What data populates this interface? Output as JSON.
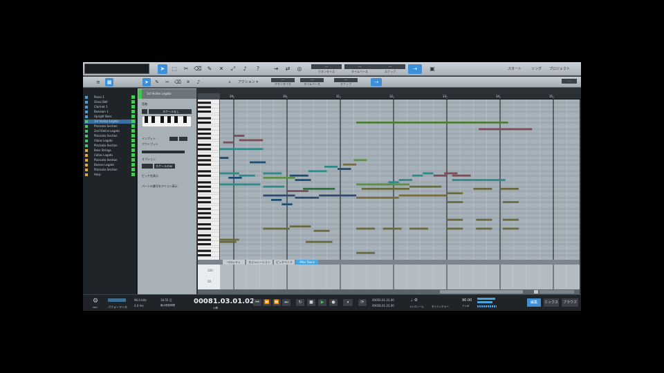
{
  "toolbar": {
    "tools": [
      "arrow",
      "range",
      "split",
      "eraser",
      "paint",
      "mute",
      "bend",
      "listen",
      "help"
    ],
    "groups": [
      {
        "value": "---",
        "caption": "クオンタイズ"
      },
      {
        "value": "---",
        "caption": "タイムベース"
      },
      {
        "value": "---",
        "caption": "スナップ"
      }
    ],
    "nav": {
      "start": "スタート",
      "song": "ソング",
      "project": "プロジェクト"
    }
  },
  "editor_toolbar": {
    "action_label": "アクション ▾",
    "groups": [
      {
        "value": "---",
        "caption": "クオンタイズ"
      },
      {
        "value": "---",
        "caption": "タイムベース"
      },
      {
        "value": "---",
        "caption": "スナップ"
      }
    ]
  },
  "tracks": [
    {
      "name": "Piano 1",
      "color": "#4f9bd6"
    },
    {
      "name": "Glass Bell",
      "color": "#4f9bd6"
    },
    {
      "name": "Clarinet 1",
      "color": "#4f9bd6"
    },
    {
      "name": "Bassoon 1",
      "color": "#4f9bd6"
    },
    {
      "name": "Upright Bass",
      "color": "#4f9bd6"
    },
    {
      "name": "1st Violins Legato",
      "color": "#4fbf6c"
    },
    {
      "name": "Pizzicato Section",
      "color": "#4fbf6c"
    },
    {
      "name": "2nd Violins Legato",
      "color": "#4fbf6c"
    },
    {
      "name": "Pizzicato Section",
      "color": "#4fbf6c"
    },
    {
      "name": "Violas Legato",
      "color": "#4fbf6c"
    },
    {
      "name": "Pizzicato Section",
      "color": "#4fbf6c"
    },
    {
      "name": "Bass Strings",
      "color": "#e0a53c"
    },
    {
      "name": "Cellos Legato",
      "color": "#e0a53c"
    },
    {
      "name": "Pizzicato Section",
      "color": "#e0a53c"
    },
    {
      "name": "Basses Legato",
      "color": "#e0a53c"
    },
    {
      "name": "Pizzicato Section",
      "color": "#e0a53c"
    },
    {
      "name": "Harp",
      "color": "#e0a53c"
    }
  ],
  "inspector": {
    "instrument": "1st Violins Legato",
    "scale_label": "音階",
    "scale_value": "スケールなし",
    "input_label": "インプット",
    "output_label": "アウトプット",
    "option_label": "オプション",
    "option_value": "スケールのみ",
    "pitch_label": "ピッチ名表示",
    "hint_label": "パートの番号をアイコン表示"
  },
  "ruler": {
    "bars": [
      "29",
      "30",
      "31",
      "32",
      "33",
      "34",
      "35"
    ]
  },
  "editor_tabs": [
    "ベロシティ",
    "モジュレーション",
    "ピッチベンド",
    "After Touch"
  ],
  "vel_lane_labels": [
    "100",
    "50"
  ],
  "transport": {
    "midi_perf_label": "MIDI",
    "perf_label": "パフォーマンス",
    "sample_rate": "96.0 kHz",
    "latency": "4.0 ms",
    "duration": "16:55 日",
    "record_max": "最大録音時間",
    "position": "00081.03.01.02",
    "position_caption": "小節",
    "loop_start": "00050.01.01.00",
    "loop_end": "00058.01.01.00",
    "metronome_label": "メトロノーム",
    "timecode_label": "タイミング",
    "key_label": "キー",
    "tempo": "90.00",
    "tempo_caption": "テンポ",
    "mode_buttons": [
      "編集",
      "ミックス",
      "ブラウズ"
    ]
  },
  "notes": [
    {
      "pitch": 22,
      "start": 0.03,
      "len": 0.62,
      "color": "#2f8a8a"
    },
    {
      "pitch": 22,
      "start": 0.65,
      "len": 0.9,
      "color": "#2f8a8a"
    },
    {
      "pitch": 18,
      "start": 1.1,
      "len": 0.45,
      "color": "#7b4d57"
    },
    {
      "pitch": 19,
      "start": 0.8,
      "len": 0.2,
      "color": "#7b4d57"
    },
    {
      "pitch": 16,
      "start": 1.0,
      "len": 0.2,
      "color": "#7b4d57"
    },
    {
      "pitch": 25,
      "start": 0.4,
      "len": 0.2,
      "color": "#1c4d72"
    },
    {
      "pitch": 26,
      "start": 0.6,
      "len": 0.3,
      "color": "#1c4d72"
    },
    {
      "pitch": 27,
      "start": 0.2,
      "len": 0.2,
      "color": "#1c4d72"
    },
    {
      "pitch": 28,
      "start": 1.3,
      "len": 0.3,
      "color": "#1c4d72"
    },
    {
      "pitch": 33,
      "start": 0.05,
      "len": 1.05,
      "color": "#2f8a8a"
    },
    {
      "pitch": 34,
      "start": 1.1,
      "len": 0.3,
      "color": "#2f8a8a"
    },
    {
      "pitch": 37,
      "start": 0.05,
      "len": 0.5,
      "color": "#2f8a8a"
    },
    {
      "pitch": 38,
      "start": 0.6,
      "len": 0.9,
      "color": "#2f8a8a"
    },
    {
      "pitch": 40,
      "start": 0.05,
      "len": 0.6,
      "color": "#356b45"
    },
    {
      "pitch": 42,
      "start": 0.05,
      "len": 0.4,
      "color": "#356b45"
    },
    {
      "pitch": 36,
      "start": 0.3,
      "len": 0.2,
      "color": "#1c4d72"
    },
    {
      "pitch": 35,
      "start": 0.9,
      "len": 0.25,
      "color": "#1c4d72"
    },
    {
      "pitch": 63,
      "start": 0.15,
      "len": 0.95,
      "color": "#6b6a3e"
    },
    {
      "pitch": 64,
      "start": 0.15,
      "len": 0.9,
      "color": "#6b6a3e"
    },
    {
      "pitch": 33,
      "start": 1.55,
      "len": 0.35,
      "color": "#2f8a8a"
    },
    {
      "pitch": 35,
      "start": 1.55,
      "len": 0.6,
      "color": "#5e8e48"
    },
    {
      "pitch": 34,
      "start": 2.05,
      "len": 0.35,
      "color": "#1c4d72"
    },
    {
      "pitch": 36,
      "start": 2.15,
      "len": 0.3,
      "color": "#1c4d72"
    },
    {
      "pitch": 32,
      "start": 2.4,
      "len": 0.35,
      "color": "#2f8a8a"
    },
    {
      "pitch": 30,
      "start": 2.7,
      "len": 0.25,
      "color": "#2f8a8a"
    },
    {
      "pitch": 31,
      "start": 2.95,
      "len": 0.25,
      "color": "#1c4d72"
    },
    {
      "pitch": 29,
      "start": 3.05,
      "len": 0.25,
      "color": "#7b6b3a"
    },
    {
      "pitch": 27,
      "start": 3.25,
      "len": 0.25,
      "color": "#5e8e48"
    },
    {
      "pitch": 39,
      "start": 1.55,
      "len": 0.4,
      "color": "#2f8a8a"
    },
    {
      "pitch": 41,
      "start": 2.0,
      "len": 0.4,
      "color": "#7b4d57"
    },
    {
      "pitch": 43,
      "start": 1.55,
      "len": 0.6,
      "color": "#2f4a6a"
    },
    {
      "pitch": 44,
      "start": 2.15,
      "len": 0.45,
      "color": "#2f4a6a"
    },
    {
      "pitch": 43,
      "start": 2.6,
      "len": 0.7,
      "color": "#2f4a6a"
    },
    {
      "pitch": 45,
      "start": 1.7,
      "len": 0.2,
      "color": "#1c4d72"
    },
    {
      "pitch": 47,
      "start": 1.9,
      "len": 0.2,
      "color": "#1c4d72"
    },
    {
      "pitch": 40,
      "start": 2.3,
      "len": 0.6,
      "color": "#356b45"
    },
    {
      "pitch": 58,
      "start": 1.55,
      "len": 0.5,
      "color": "#6b6a3e"
    },
    {
      "pitch": 57,
      "start": 2.05,
      "len": 0.4,
      "color": "#6b6a3e"
    },
    {
      "pitch": 59,
      "start": 2.5,
      "len": 0.3,
      "color": "#6b6a3e"
    },
    {
      "pitch": 64,
      "start": 2.35,
      "len": 0.5,
      "color": "#6b6a3e"
    },
    {
      "pitch": 10,
      "start": 3.3,
      "len": 2.85,
      "color": "#4e7d39"
    },
    {
      "pitch": 13,
      "start": 5.6,
      "len": 1.0,
      "color": "#7b4d57"
    },
    {
      "pitch": 38,
      "start": 3.7,
      "len": 0.2,
      "color": "#2f8a8a"
    },
    {
      "pitch": 37,
      "start": 3.9,
      "len": 0.2,
      "color": "#2f8a8a"
    },
    {
      "pitch": 36,
      "start": 4.1,
      "len": 0.25,
      "color": "#2f8a8a"
    },
    {
      "pitch": 34,
      "start": 4.35,
      "len": 0.2,
      "color": "#2f8a8a"
    },
    {
      "pitch": 33,
      "start": 4.55,
      "len": 0.2,
      "color": "#2f8a8a"
    },
    {
      "pitch": 34,
      "start": 4.75,
      "len": 0.25,
      "color": "#7b4d57"
    },
    {
      "pitch": 33,
      "start": 4.95,
      "len": 0.25,
      "color": "#7b4d57"
    },
    {
      "pitch": 34,
      "start": 5.1,
      "len": 0.35,
      "color": "#7b4d57"
    },
    {
      "pitch": 36,
      "start": 5.1,
      "len": 1.0,
      "color": "#2f8a8a"
    },
    {
      "pitch": 38,
      "start": 3.3,
      "len": 1.0,
      "color": "#5e8e48"
    },
    {
      "pitch": 40,
      "start": 3.4,
      "len": 0.9,
      "color": "#6b6a3e"
    },
    {
      "pitch": 39,
      "start": 4.3,
      "len": 0.6,
      "color": "#6b6a3e"
    },
    {
      "pitch": 44,
      "start": 3.3,
      "len": 0.8,
      "color": "#7b6b3a"
    },
    {
      "pitch": 43,
      "start": 4.1,
      "len": 0.9,
      "color": "#7b6b3a"
    },
    {
      "pitch": 42,
      "start": 5.0,
      "len": 0.3,
      "color": "#6b6a3e"
    },
    {
      "pitch": 40,
      "start": 5.5,
      "len": 0.35,
      "color": "#6b6a3e"
    },
    {
      "pitch": 40,
      "start": 6.0,
      "len": 0.35,
      "color": "#6b6a3e"
    },
    {
      "pitch": 46,
      "start": 5.0,
      "len": 0.3,
      "color": "#6b6a3e"
    },
    {
      "pitch": 46,
      "start": 6.05,
      "len": 0.3,
      "color": "#6b6a3e"
    },
    {
      "pitch": 54,
      "start": 5.0,
      "len": 0.3,
      "color": "#6b6a3e"
    },
    {
      "pitch": 54,
      "start": 5.55,
      "len": 0.3,
      "color": "#6b6a3e"
    },
    {
      "pitch": 54,
      "start": 6.05,
      "len": 0.3,
      "color": "#6b6a3e"
    },
    {
      "pitch": 58,
      "start": 5.0,
      "len": 0.3,
      "color": "#6b6a3e"
    },
    {
      "pitch": 58,
      "start": 5.55,
      "len": 0.3,
      "color": "#6b6a3e"
    },
    {
      "pitch": 58,
      "start": 6.05,
      "len": 0.3,
      "color": "#6b6a3e"
    },
    {
      "pitch": 58,
      "start": 3.3,
      "len": 0.35,
      "color": "#6b6a3e"
    },
    {
      "pitch": 58,
      "start": 3.8,
      "len": 0.35,
      "color": "#6b6a3e"
    },
    {
      "pitch": 58,
      "start": 4.3,
      "len": 0.35,
      "color": "#6b6a3e"
    },
    {
      "pitch": 69,
      "start": 3.3,
      "len": 0.35,
      "color": "#6b6a3e"
    }
  ]
}
